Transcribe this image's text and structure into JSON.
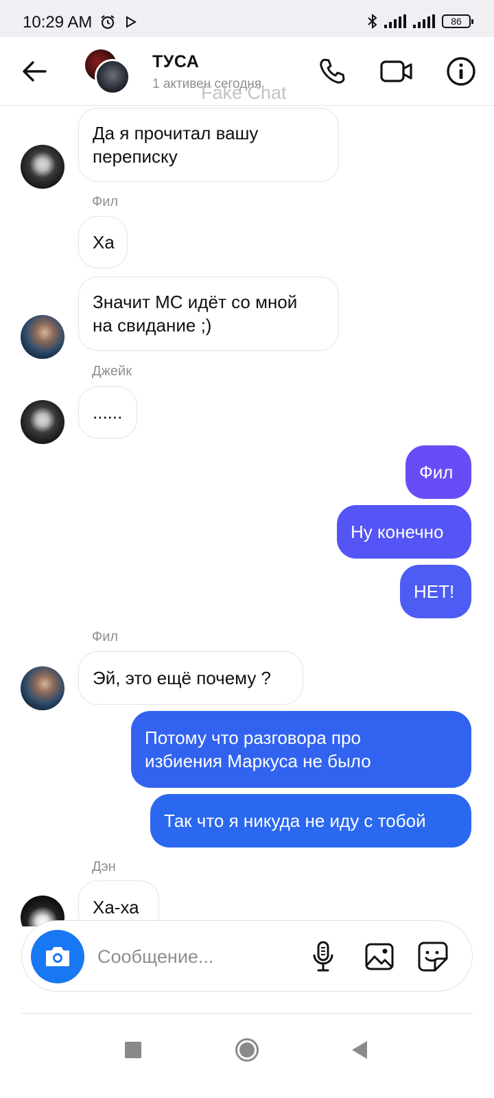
{
  "status_bar": {
    "time": "10:29 AM",
    "battery": "86"
  },
  "header": {
    "title": "ТУСА",
    "subtitle": "1 активен сегодня",
    "watermark": "Fake Chat"
  },
  "colors": {
    "accent_blue": "#1877f2",
    "bubble_purple": "#6a4cf7",
    "bubble_indigo": "#4d5cf2",
    "bubble_blue": "#2a68ef"
  },
  "messages": [
    {
      "sender": "",
      "text_lines": [
        "Да я прочитал вашу",
        "переписку"
      ],
      "direction": "in"
    },
    {
      "sender": "Фил",
      "text_lines": [
        "Ха"
      ],
      "direction": "in"
    },
    {
      "sender": "",
      "text_lines": [
        "Значит МС идёт со мной",
        "на свидание ;)"
      ],
      "direction": "in"
    },
    {
      "sender": "Джейк",
      "text_lines": [
        "......"
      ],
      "direction": "in"
    },
    {
      "sender": "",
      "text_lines": [
        "Фил"
      ],
      "direction": "out"
    },
    {
      "sender": "",
      "text_lines": [
        "Ну конечно"
      ],
      "direction": "out"
    },
    {
      "sender": "",
      "text_lines": [
        "НЕТ!"
      ],
      "direction": "out"
    },
    {
      "sender": "Фил",
      "text_lines": [
        "Эй, это ещё почему ?"
      ],
      "direction": "in"
    },
    {
      "sender": "",
      "text_lines": [
        "Потому что разговора про",
        "избиения Маркуса не было"
      ],
      "direction": "out"
    },
    {
      "sender": "",
      "text_lines": [
        "Так что я никуда не иду с тобой"
      ],
      "direction": "out"
    },
    {
      "sender": "Дэн",
      "text_lines": [
        "Ха-ха"
      ],
      "direction": "in"
    }
  ],
  "composer": {
    "placeholder": "Сообщение..."
  },
  "icons": {
    "back": "arrow-left-icon",
    "call": "phone-icon",
    "video": "video-camera-icon",
    "info": "info-icon",
    "camera": "camera-icon",
    "mic": "microphone-icon",
    "gallery": "image-icon",
    "sticker": "sticker-icon"
  }
}
